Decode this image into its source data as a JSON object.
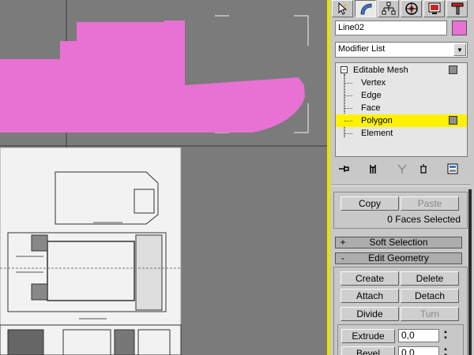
{
  "object": {
    "name": "Line02",
    "color": "#e871d4"
  },
  "modifier_list": {
    "label": "Modifier List"
  },
  "stack": {
    "root": "Editable Mesh",
    "items": [
      "Vertex",
      "Edge",
      "Face",
      "Polygon",
      "Element"
    ],
    "selected": "Polygon"
  },
  "selection": {
    "copy_label": "Copy",
    "paste_label": "Paste",
    "status": "0 Faces Selected"
  },
  "rollouts": {
    "soft_selection": {
      "sign": "+",
      "title": "Soft Selection"
    },
    "edit_geometry": {
      "sign": "-",
      "title": "Edit Geometry"
    }
  },
  "edit_geometry": {
    "create": "Create",
    "delete": "Delete",
    "attach": "Attach",
    "detach": "Detach",
    "divide": "Divide",
    "turn": "Turn",
    "extrude": "Extrude",
    "extrude_value": "0,0",
    "bevel": "Bevel",
    "bevel_value": "0,0"
  },
  "icons": {
    "tabs": [
      "create-icon",
      "modify-icon",
      "hierarchy-icon",
      "motion-icon",
      "display-icon",
      "utilities-icon"
    ],
    "stack_tools": [
      "pin-stack-icon",
      "show-end-result-icon",
      "make-unique-icon",
      "remove-modifier-icon",
      "configure-modifier-sets-icon"
    ]
  },
  "colors": {
    "selection_highlight": "#fff200",
    "viewport_active_border": "#e8e200",
    "shape_fill": "#e871d4"
  }
}
